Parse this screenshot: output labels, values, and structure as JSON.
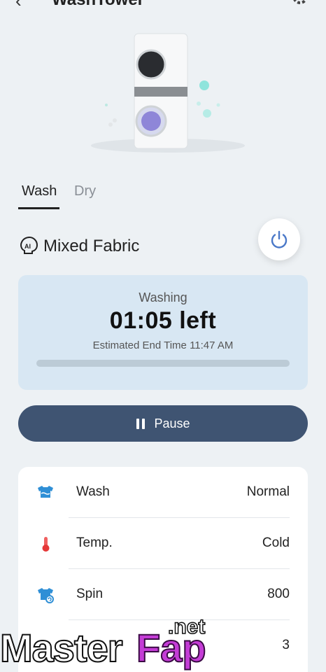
{
  "header": {
    "title": "WashTower",
    "back_icon": "chevron-left-icon",
    "settings_icon": "gear-icon"
  },
  "tabs": [
    {
      "label": "Wash",
      "active": true
    },
    {
      "label": "Dry",
      "active": false
    }
  ],
  "program": {
    "ai_icon": "ai-laundry-icon",
    "name": "Mixed Fabric"
  },
  "power": {
    "icon": "power-icon",
    "color": "#4a78c8"
  },
  "status": {
    "state": "Washing",
    "time_left": "01:05 left",
    "end_time": "Estimated End Time 11:47 AM",
    "progress": 0
  },
  "pause_button": {
    "label": "Pause",
    "icon": "pause-icon"
  },
  "settings": [
    {
      "label": "Wash",
      "value": "Normal",
      "icon": "wash-shirt-icon"
    },
    {
      "label": "Temp.",
      "value": "Cold",
      "icon": "thermometer-icon"
    },
    {
      "label": "Spin",
      "value": "800",
      "icon": "spin-shirt-icon"
    },
    {
      "label": "",
      "value": "3",
      "icon": ""
    }
  ],
  "watermark": {
    "main": "Master",
    "accent": "Fap",
    "suffix": ".net"
  },
  "colors": {
    "background": "#edf1f4",
    "status_card": "#d8e7f3",
    "pause_button": "#3f5472",
    "accent_blue": "#4a78c8"
  }
}
